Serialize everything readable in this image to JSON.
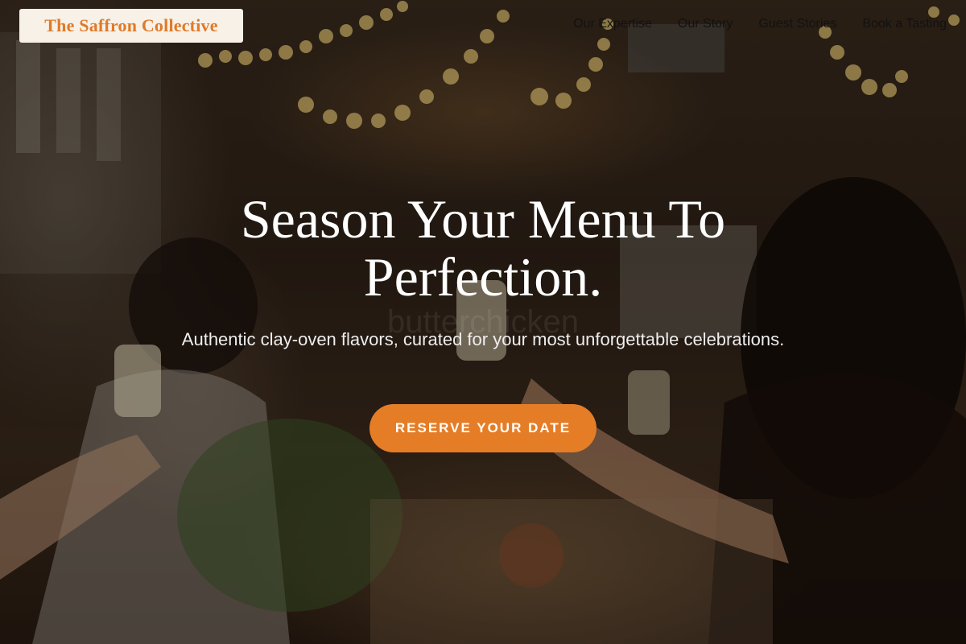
{
  "brand": {
    "name": "The Saffron Collective",
    "accent": "#e57d27"
  },
  "nav": {
    "items": [
      {
        "label": "Our Expertise"
      },
      {
        "label": "Our Story"
      },
      {
        "label": "Guest Stories"
      },
      {
        "label": "Book a Tasting"
      }
    ]
  },
  "hero": {
    "headline": "Season Your Menu To Perfection.",
    "subtitle": "Authentic clay-oven flavors, curated for your most unforgettable celebrations.",
    "cta_label": "RESERVE YOUR DATE",
    "watermark": "butterchicken"
  }
}
